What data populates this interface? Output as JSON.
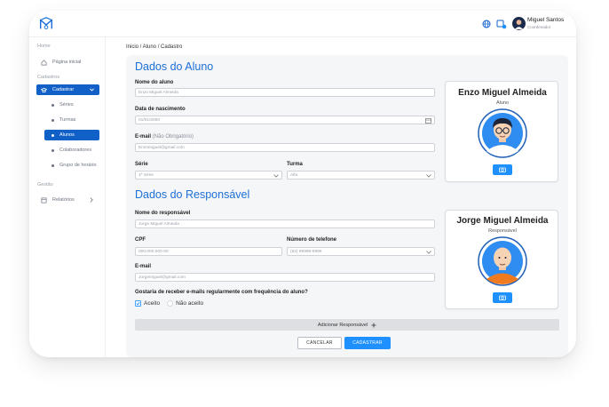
{
  "header": {
    "user_name": "Miguel Santos",
    "user_role": "Coordenador"
  },
  "sidebar": {
    "sections": [
      "Home",
      "Cadastros",
      "Gestão"
    ],
    "home_item": "Página inicial",
    "cadastrar": "Cadastrar",
    "sub_items": [
      "Séries",
      "Turmas",
      "Alunos",
      "Colaboradores",
      "Grupo de horário"
    ],
    "relatorios": "Relatórios"
  },
  "breadcrumb": "Inicio / Aluno / Cadastro",
  "aluno": {
    "title": "Dados do Aluno",
    "nome_label": "Nome do aluno",
    "nome_value": "Enzo Miguel Almeida",
    "nasc_label": "Data de nascimento",
    "nasc_value": "01/01/2000",
    "email_label": "E-mail",
    "email_optional": "(Não Obrigatório)",
    "email_value": "Enzomiguel@gmail.com",
    "serie_label": "Série",
    "serie_value": "1ª Série",
    "turma_label": "Turma",
    "turma_value": "Alfa",
    "card_name": "Enzo Miguel Almeida",
    "card_role": "Aluno"
  },
  "responsavel": {
    "title": "Dados do Responsável",
    "nome_label": "Nome do responsável",
    "nome_value": "Jorge Miguel Almeida",
    "cpf_label": "CPF",
    "cpf_placeholder": "000.000.000-00",
    "tel_label": "Número de telefone",
    "tel_placeholder": "(62) 99999-9999",
    "email_label": "E-mail",
    "email_value": "Jorgemiguel@gmail.com",
    "question": "Gostaria de receber e-mails regularmente com frequência do aluno?",
    "opt_yes": "Aceito",
    "opt_no": "Não aceito",
    "card_name": "Jorge Miguel Almeida",
    "card_role": "Responsável"
  },
  "actions": {
    "add_responsavel": "Adicionar Responsável",
    "cancel": "CANCELAR",
    "save": "CADASTRAR"
  },
  "colors": {
    "primary": "#1160c8",
    "accent": "#1e90ff",
    "title_blue": "#1c6fd6"
  }
}
